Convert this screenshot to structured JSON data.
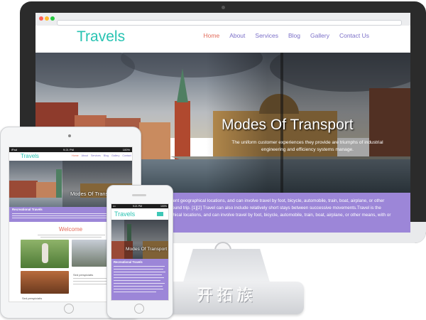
{
  "brand": {
    "logo_text": "Travels",
    "watermark": "开拓族",
    "accent_color": "#28c3b2",
    "nav_color": "#7b6fc8",
    "active_color": "#e26b5a",
    "panel_color": "#9c86d8"
  },
  "desktop": {
    "nav": [
      {
        "label": "Home",
        "active": true
      },
      {
        "label": "About",
        "active": false
      },
      {
        "label": "Services",
        "active": false
      },
      {
        "label": "Blog",
        "active": false
      },
      {
        "label": "Gallery",
        "active": false
      },
      {
        "label": "Contact Us",
        "active": false
      }
    ],
    "hero": {
      "title": "Modes Of Transport",
      "subtitle": "The uniform customer experiences they provide are triumphs of industrial engineering and efficiency systems manage."
    },
    "purple_lines": [
      "dent geographical locations, and can involve travel by foot, bicycle, automobile, train, boat, airplane, or other",
      "round trip. [1][2] Travel can also include relatively short stays between successive movements.Travel is the",
      "phical locations, and can involve travel by foot, bicycle, automobile, train, boat, airplane, or other means, with or"
    ]
  },
  "tablet": {
    "status": {
      "left": "iPad",
      "center": "9:21 PM",
      "right": "100%"
    },
    "nav": [
      "Home",
      "About",
      "Services",
      "Blog",
      "Gallery",
      "Contact"
    ],
    "hero_title": "Modes Of Transport",
    "section_heading": "Recreational Travels",
    "welcome_title": "Welcome",
    "caption_1": "Sed perspiciatis",
    "caption_2": "Sed perspiciatis"
  },
  "phone": {
    "status": {
      "left": "•••",
      "center": "9:21 PM",
      "right": "100%"
    },
    "hero_title": "Modes Of Transport",
    "section_heading": "Recreational Travels"
  }
}
